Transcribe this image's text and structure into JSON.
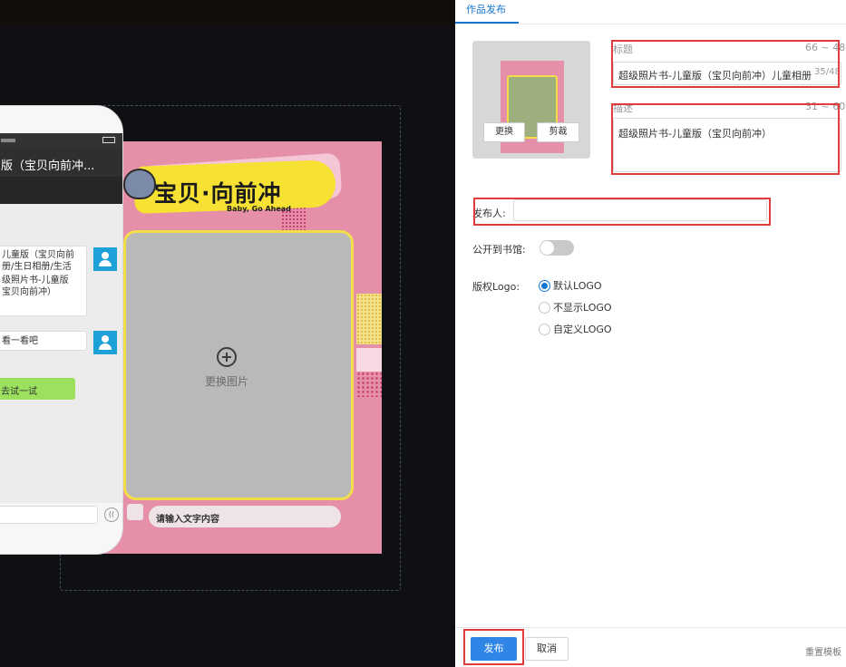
{
  "editor": {
    "banner_title": "宝贝·向前冲",
    "banner_subtitle": "Baby, Go Ahead",
    "photo_placeholder": "更换图片",
    "text_placeholder": "请输入文字内容"
  },
  "phone_preview": {
    "title": "版（宝贝向前冲...",
    "card_lines": [
      "儿童版（宝贝向前",
      "册/生日相册/生活",
      "级照片书-儿童版",
      "宝贝向前冲）"
    ],
    "message": "看一看吧",
    "action_button": "去试一试",
    "voice_icon": "(("
  },
  "panel": {
    "tab_label": "作品发布",
    "thumb_replace_label": "更换",
    "thumb_crop_label": "剪裁",
    "title_label": "标题",
    "title_range": "66 ~ 48",
    "title_value": "超级照片书-儿童版（宝贝向前冲）儿童相册",
    "title_count": "35/48",
    "desc_label": "描述",
    "desc_range": "31 ~ 60",
    "desc_value": "超级照片书-儿童版（宝贝向前冲）",
    "publisher_label": "发布人:",
    "publisher_value": "",
    "public_label": "公开到书馆:",
    "public_on": false,
    "logo_label": "版权Logo:",
    "logo_options": [
      "默认LOGO",
      "不显示LOGO",
      "自定义LOGO"
    ],
    "logo_selected": "默认LOGO",
    "publish_button": "发布",
    "cancel_button": "取消",
    "reset_link": "重置模板"
  },
  "colors": {
    "accent": "#2f86e6",
    "annotation": "#e03c3c",
    "design_bg": "#e58fa9",
    "banner": "#f7e233"
  }
}
